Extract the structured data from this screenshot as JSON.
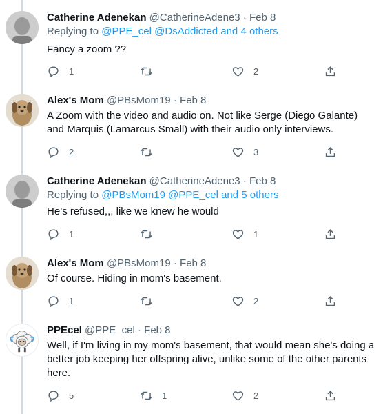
{
  "tweets": [
    {
      "name": "Catherine Adenekan",
      "handle": "@CatherineAdene3",
      "dot": "·",
      "date": "Feb 8",
      "replying_prefix": "Replying to ",
      "replying_mentions": "@PPE_cel @DsAddicted and 4 others",
      "text": "Fancy a zoom ??",
      "replies": "1",
      "retweets": "",
      "likes": "2",
      "avatar": "catherine-avatar"
    },
    {
      "name": "Alex's Mom",
      "handle": "@PBsMom19",
      "dot": "·",
      "date": "Feb 8",
      "text": "A Zoom with the video and audio on. Not like Serge (Diego Galante) and Marquis (Lamarcus Small) with their audio only interviews.",
      "replies": "2",
      "retweets": "",
      "likes": "3",
      "avatar": "dog-avatar"
    },
    {
      "name": "Catherine Adenekan",
      "handle": "@CatherineAdene3",
      "dot": "·",
      "date": "Feb 8",
      "replying_prefix": "Replying to ",
      "replying_mentions": "@PBsMom19 @PPE_cel and 5 others",
      "text": "He’s refused,,, like we knew he would",
      "replies": "1",
      "retweets": "",
      "likes": "1",
      "avatar": "catherine-avatar"
    },
    {
      "name": "Alex's Mom",
      "handle": "@PBsMom19",
      "dot": "·",
      "date": "Feb 8",
      "text": "Of course. Hiding in mom's basement.",
      "replies": "1",
      "retweets": "",
      "likes": "2",
      "avatar": "dog-avatar"
    },
    {
      "name": "PPEcel",
      "handle": "@PPE_cel",
      "dot": "·",
      "date": "Feb 8",
      "text": "Well, if I'm living in my mom's basement, that would mean she's doing a better job keeping her offspring alive, unlike some of the other parents here.",
      "replies": "5",
      "retweets": "1",
      "likes": "2",
      "avatar": "sheep-avatar"
    }
  ],
  "icons": {
    "reply": "reply-icon",
    "retweet": "retweet-icon",
    "like": "heart-icon",
    "share": "share-icon"
  },
  "colors": {
    "text": "#0f1419",
    "secondary": "#536471",
    "link": "#1d9bf0",
    "thread_line": "#cfd9de"
  }
}
